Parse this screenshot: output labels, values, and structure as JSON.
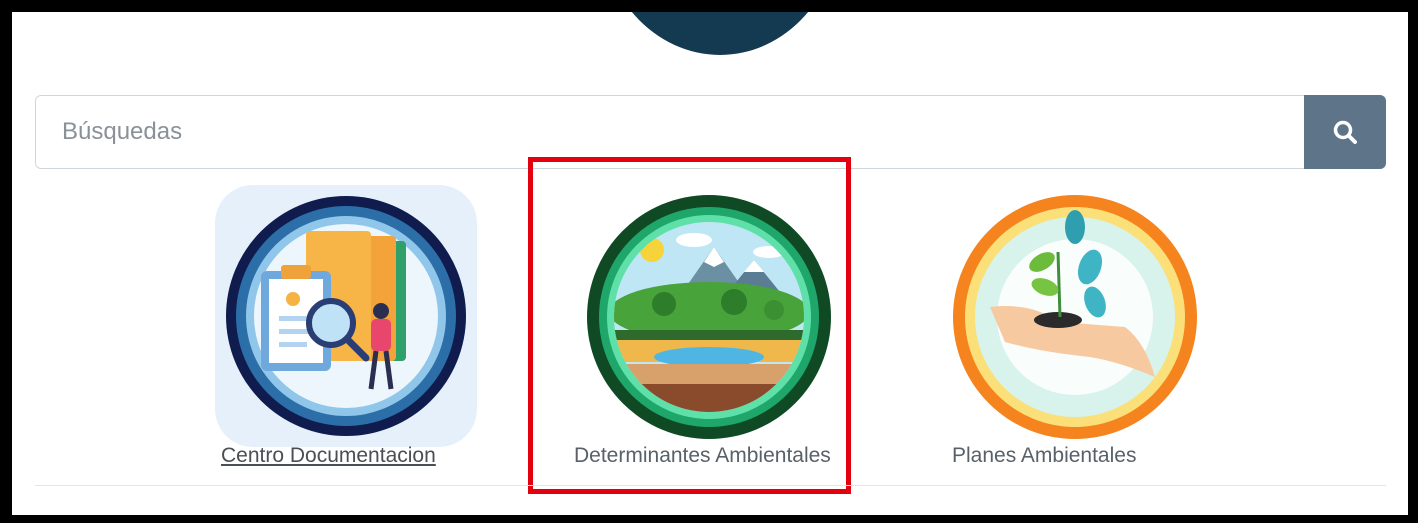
{
  "search": {
    "placeholder": "Búsquedas",
    "button_icon": "search-icon"
  },
  "cards": [
    {
      "label": "Centro Documentacion",
      "icon": "documents-magnifier-icon",
      "link": true
    },
    {
      "label": "Determinantes Ambientales",
      "icon": "landscape-layers-icon",
      "link": false,
      "highlighted": true
    },
    {
      "label": "Planes Ambientales",
      "icon": "hand-plant-icon",
      "link": false
    }
  ],
  "colors": {
    "search_button": "#5d7489",
    "highlight_border": "#e3000f",
    "logo": "#143a52"
  }
}
